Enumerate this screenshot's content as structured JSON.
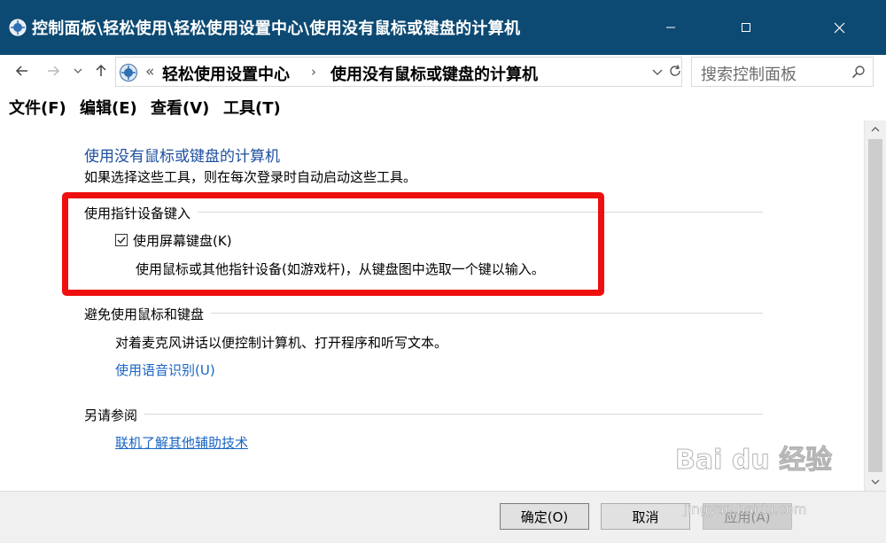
{
  "window": {
    "title": "控制面板\\轻松使用\\轻松使用设置中心\\使用没有鼠标或键盘的计算机",
    "title_bar_color": "#0d4a73"
  },
  "address_bar": {
    "breadcrumb_parent": "轻松使用设置中心",
    "breadcrumb_current": "使用没有鼠标或键盘的计算机",
    "separator_left": "«",
    "separator_mid": "›"
  },
  "search": {
    "placeholder": "搜索控制面板"
  },
  "menu": {
    "file": "文件(F)",
    "edit": "编辑(E)",
    "view": "查看(V)",
    "tools": "工具(T)"
  },
  "page": {
    "title": "使用没有鼠标或键盘的计算机",
    "description": "如果选择这些工具，则在每次登录时自动启动这些工具。",
    "sections": {
      "pointing": {
        "heading": "使用指针设备键入",
        "checkbox_label": "使用屏幕键盘(K)",
        "checkbox_checked": true,
        "checkbox_description": "使用鼠标或其他指针设备(如游戏杆)，从键盘图中选取一个键以输入。"
      },
      "speech": {
        "heading": "避免使用鼠标和键盘",
        "description": "对着麦克风讲话以便控制计算机、打开程序和听写文本。",
        "link": "使用语音识别(U)"
      },
      "see_also": {
        "heading": "另请参阅",
        "link": "联机了解其他辅助技术"
      }
    }
  },
  "buttons": {
    "ok": "确定(O)",
    "cancel": "取消",
    "apply": "应用(A)"
  },
  "watermark": {
    "brand": "Bai du 经验",
    "url": "jingyan.baidu.com"
  },
  "colors": {
    "link": "#1a65c2",
    "title": "#1e4fa0",
    "highlight": "#ee0f0f"
  }
}
